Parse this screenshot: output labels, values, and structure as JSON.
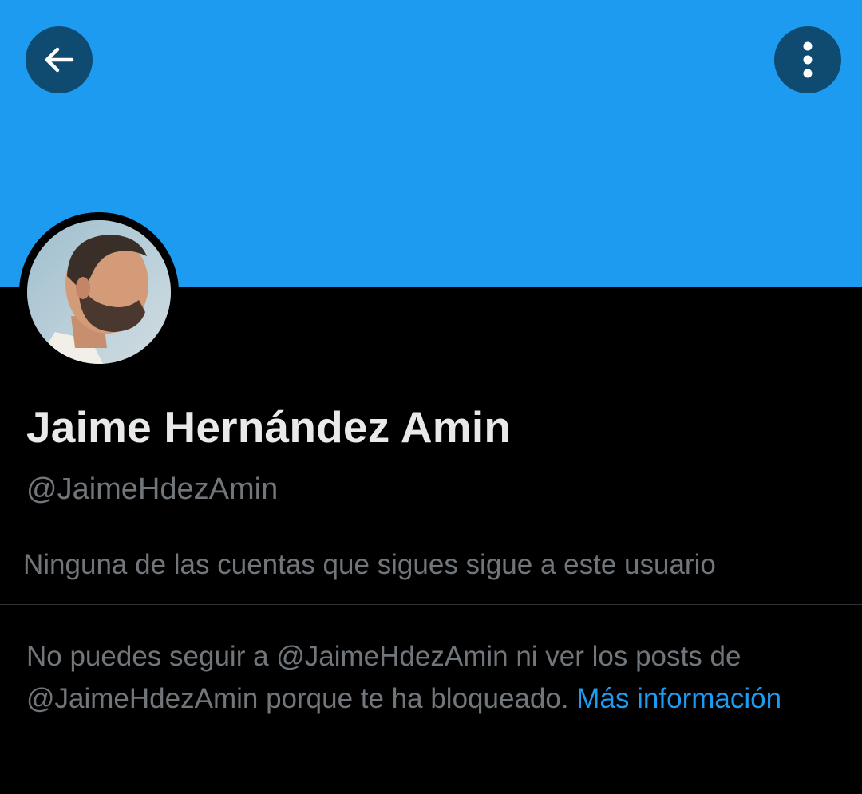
{
  "header": {
    "banner_color": "#1d9bf0",
    "back_icon": "arrow-left-icon",
    "more_icon": "more-vertical-icon"
  },
  "profile": {
    "display_name": "Jaime Hernández Amin",
    "handle": "@JaimeHdezAmin",
    "followers_you_know": "Ninguna de las cuentas que sigues sigue a este usuario"
  },
  "blocked_notice": {
    "line_1": "No puedes seguir a @JaimeHdezAmin ni ver los posts de @JaimeHdezAmin porque te ha bloqueado.",
    "link_label": "Más información",
    "link_color": "#1d9bf0"
  }
}
